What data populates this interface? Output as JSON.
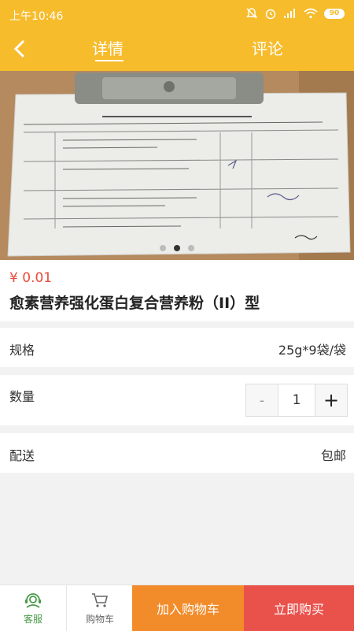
{
  "status": {
    "time": "上午10:46",
    "battery": "90"
  },
  "nav": {
    "tab_detail": "详情",
    "tab_comment": "评论"
  },
  "gallery": {
    "total": 3,
    "active_index": 1
  },
  "product": {
    "price": "¥ 0.01",
    "title": "愈素营养强化蛋白复合营养粉（II）型"
  },
  "spec": {
    "label": "规格",
    "value": "25g*9袋/袋"
  },
  "quantity": {
    "label": "数量",
    "minus": "-",
    "value": "1",
    "plus": "+"
  },
  "shipping": {
    "label": "配送",
    "value": "包邮"
  },
  "bottom": {
    "service_label": "客服",
    "cart_label": "购物车",
    "add_to_cart": "加入购物车",
    "buy_now": "立即购买"
  },
  "colors": {
    "accent": "#f6bc2c",
    "price": "#e94a3a",
    "add_to_cart": "#f28b2a",
    "buy_now": "#e9514b"
  }
}
